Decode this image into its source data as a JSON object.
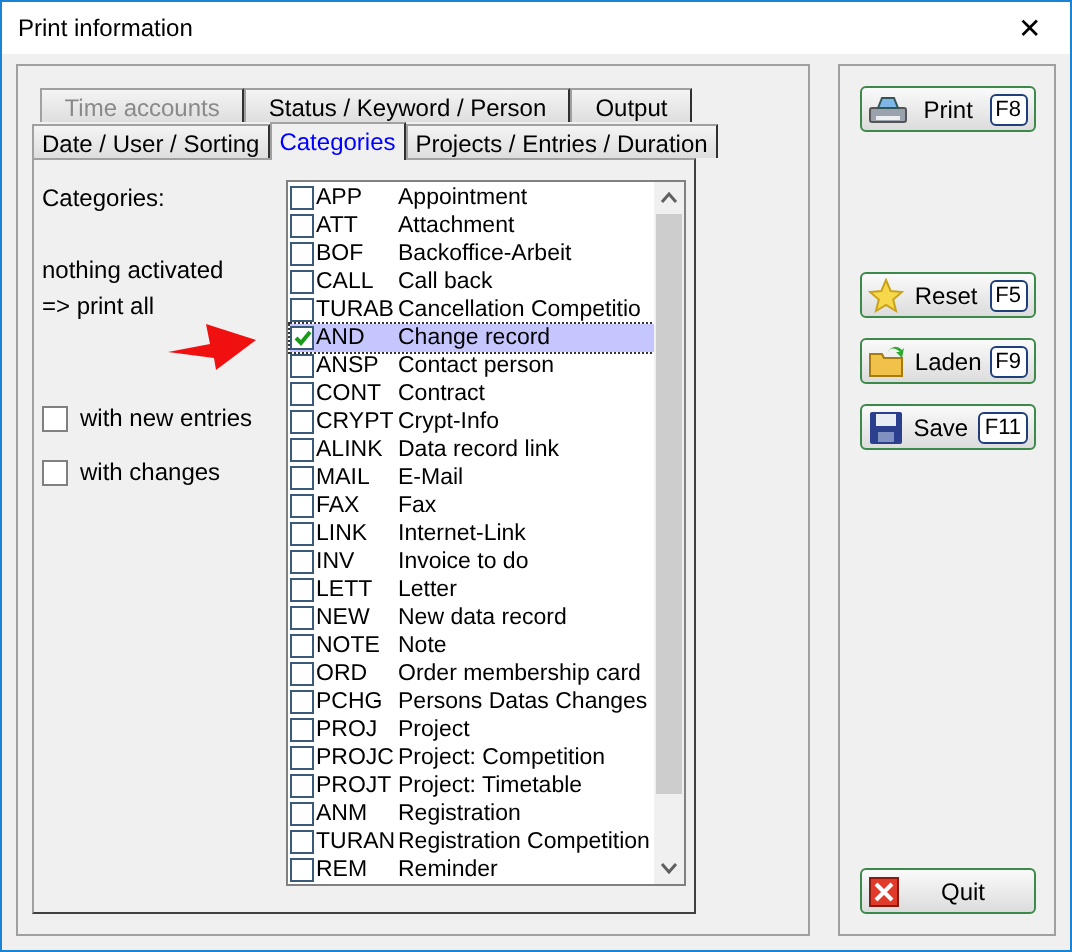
{
  "window": {
    "title": "Print information",
    "close": "✕"
  },
  "tabs": [
    [
      {
        "label": "Time accounts",
        "selected": false,
        "disabled": true
      },
      {
        "label": "Status / Keyword / Person",
        "selected": false,
        "disabled": false
      },
      {
        "label": "Output",
        "selected": false,
        "disabled": false
      }
    ],
    [
      {
        "label": "Date / User / Sorting",
        "selected": false,
        "disabled": false
      },
      {
        "label": "Categories",
        "selected": true,
        "disabled": false
      },
      {
        "label": "Projects / Entries / Duration",
        "selected": false,
        "disabled": false
      }
    ]
  ],
  "categories_label": "Categories:",
  "hint": [
    "nothing activated",
    "=> print all"
  ],
  "options": [
    {
      "label": "with new entries",
      "checked": false
    },
    {
      "label": "with changes",
      "checked": false
    }
  ],
  "categories": [
    {
      "code": "APP",
      "name": "Appointment",
      "checked": false,
      "selected": false
    },
    {
      "code": "ATT",
      "name": "Attachment",
      "checked": false,
      "selected": false
    },
    {
      "code": "BOF",
      "name": "Backoffice-Arbeit",
      "checked": false,
      "selected": false
    },
    {
      "code": "CALL",
      "name": "Call back",
      "checked": false,
      "selected": false
    },
    {
      "code": "TURAB",
      "name": "Cancellation Competitio",
      "checked": false,
      "selected": false
    },
    {
      "code": "AND",
      "name": "Change record",
      "checked": true,
      "selected": true
    },
    {
      "code": "ANSP",
      "name": "Contact person",
      "checked": false,
      "selected": false
    },
    {
      "code": "CONT",
      "name": "Contract",
      "checked": false,
      "selected": false
    },
    {
      "code": "CRYPT",
      "name": "Crypt-Info",
      "checked": false,
      "selected": false
    },
    {
      "code": "ALINK",
      "name": "Data record link",
      "checked": false,
      "selected": false
    },
    {
      "code": "MAIL",
      "name": "E-Mail",
      "checked": false,
      "selected": false
    },
    {
      "code": "FAX",
      "name": "Fax",
      "checked": false,
      "selected": false
    },
    {
      "code": "LINK",
      "name": "Internet-Link",
      "checked": false,
      "selected": false
    },
    {
      "code": "INV",
      "name": "Invoice to do",
      "checked": false,
      "selected": false
    },
    {
      "code": "LETT",
      "name": "Letter",
      "checked": false,
      "selected": false
    },
    {
      "code": "NEW",
      "name": "New data record",
      "checked": false,
      "selected": false
    },
    {
      "code": "NOTE",
      "name": "Note",
      "checked": false,
      "selected": false
    },
    {
      "code": "ORD",
      "name": "Order membership card",
      "checked": false,
      "selected": false
    },
    {
      "code": "PCHG",
      "name": "Persons Datas Changes",
      "checked": false,
      "selected": false
    },
    {
      "code": "PROJ",
      "name": "Project",
      "checked": false,
      "selected": false
    },
    {
      "code": "PROJC",
      "name": "Project: Competition",
      "checked": false,
      "selected": false
    },
    {
      "code": "PROJT",
      "name": "Project: Timetable",
      "checked": false,
      "selected": false
    },
    {
      "code": "ANM",
      "name": "Registration",
      "checked": false,
      "selected": false
    },
    {
      "code": "TURAN",
      "name": "Registration Competition",
      "checked": false,
      "selected": false
    },
    {
      "code": "REM",
      "name": "Reminder",
      "checked": false,
      "selected": false
    }
  ],
  "buttons": [
    {
      "kind": "print",
      "label": "Print",
      "key": "F8"
    },
    {
      "kind": "gap"
    },
    {
      "kind": "reset",
      "label": "Reset",
      "key": "F5"
    },
    {
      "kind": "load",
      "label": "Laden",
      "key": "F9"
    },
    {
      "kind": "save",
      "label": "Save",
      "key": "F11"
    },
    {
      "kind": "spacer"
    },
    {
      "kind": "quit",
      "label": "Quit"
    }
  ]
}
